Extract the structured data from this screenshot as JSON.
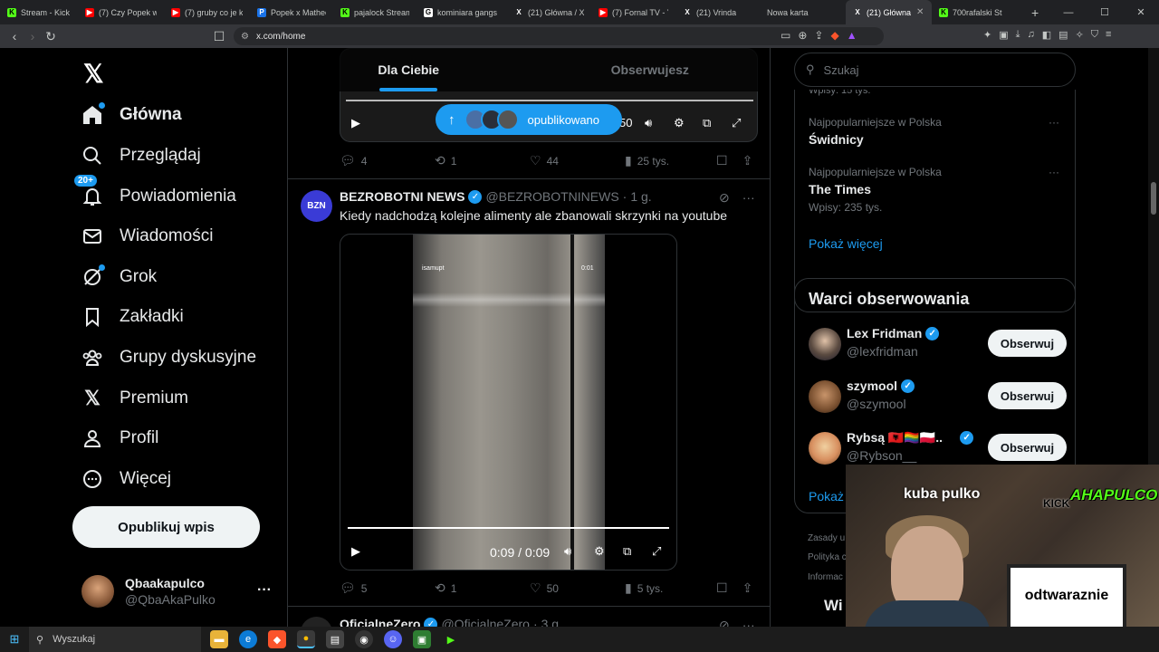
{
  "browser": {
    "tabs": [
      {
        "label": "Stream - Kick",
        "icon": "kick-icon",
        "color": "#53fc18",
        "glyph": "K"
      },
      {
        "label": "(7) Czy Popek w b",
        "icon": "youtube-icon",
        "color": "#ff0000",
        "glyph": "▶"
      },
      {
        "label": "(7) gruby co je ko",
        "icon": "youtube-icon",
        "color": "#ff0000",
        "glyph": "▶"
      },
      {
        "label": "Popek x Matheo",
        "icon": "page-icon",
        "color": "#1a73e8",
        "glyph": "P"
      },
      {
        "label": "pajalock Stream",
        "icon": "kick-icon",
        "color": "#53fc18",
        "glyph": "K"
      },
      {
        "label": "kominiara gangs",
        "icon": "google-icon",
        "color": "#ffffff",
        "glyph": "G"
      },
      {
        "label": "(21) Główna / X",
        "icon": "x-icon",
        "color": "#000000",
        "glyph": "X"
      },
      {
        "label": "(7) Fornal TV - Yo",
        "icon": "youtube-icon",
        "color": "#ff0000",
        "glyph": "▶"
      },
      {
        "label": "(21) Vrinda",
        "icon": "x-icon",
        "color": "#000000",
        "glyph": "X"
      },
      {
        "label": "Nowa karta",
        "icon": "",
        "color": "",
        "glyph": ""
      },
      {
        "label": "(21) Główna",
        "icon": "x-icon",
        "color": "#000000",
        "glyph": "X",
        "active": true
      },
      {
        "label": "700rafalski St",
        "icon": "kick-icon",
        "color": "#53fc18",
        "glyph": "K"
      }
    ],
    "url": "x.com/home"
  },
  "nav": {
    "items": [
      {
        "label": "Główna",
        "icon": "home-icon"
      },
      {
        "label": "Przeglądaj",
        "icon": "search-icon"
      },
      {
        "label": "Powiadomienia",
        "icon": "bell-icon",
        "badge": "20+"
      },
      {
        "label": "Wiadomości",
        "icon": "mail-icon"
      },
      {
        "label": "Grok",
        "icon": "grok-icon"
      },
      {
        "label": "Zakładki",
        "icon": "bookmark-icon"
      },
      {
        "label": "Grupy dyskusyjne",
        "icon": "people-icon"
      },
      {
        "label": "Premium",
        "icon": "x-icon"
      },
      {
        "label": "Profil",
        "icon": "person-icon"
      },
      {
        "label": "Więcej",
        "icon": "more-icon"
      }
    ],
    "post_button": "Opublikuj wpis",
    "account": {
      "display_name": "Qbaakapulco",
      "handle": "@QbaAkaPulko"
    }
  },
  "feed": {
    "tabs": [
      "Dla Ciebie",
      "Obserwujesz"
    ],
    "new_posts_pill": "opublikowano",
    "post1": {
      "video_time_fragment": "50",
      "replies": "4",
      "reposts": "1",
      "likes": "44",
      "views": "25 tys."
    },
    "post2": {
      "display_name": "BEZROBOTNI NEWS",
      "handle": "@BEZROBOTNINEWS",
      "time": "1 g.",
      "text": "Kiedy nadchodzą kolejne alimenty ale zbanowali skrzynki na youtube",
      "avatar_text": "BZN",
      "video_watermark_user": "isamupt",
      "video_watermark_time": "0:01",
      "video_time": "0:09 / 0:09",
      "replies": "5",
      "reposts": "1",
      "likes": "50",
      "views": "5 tys."
    },
    "post3": {
      "display_name": "OficjalneZero",
      "handle": "@OficjalneZero",
      "time": "3 g."
    }
  },
  "sidebar": {
    "search_placeholder": "Szukaj",
    "trend_top_fragment": "Wpisy: 15 tys.",
    "trends": [
      {
        "context": "Najpopularniejsze w Polska",
        "title": "Świdnicy",
        "count": ""
      },
      {
        "context": "Najpopularniejsze w Polska",
        "title": "The Times",
        "count": "Wpisy: 235 tys."
      }
    ],
    "show_more": "Pokaż więcej",
    "who_to_follow_title": "Warci obserwowania",
    "who_to_follow": [
      {
        "name": "Lex Fridman",
        "handle": "@lexfridman",
        "button": "Obserwuj"
      },
      {
        "name": "szymool",
        "handle": "@szymool",
        "button": "Obserwuj"
      },
      {
        "name": "Rybsą 🇦🇱🏳️‍🌈🇵🇱...",
        "handle": "@Rybson__",
        "button": "Obserwuj"
      }
    ],
    "show_more_2": "Pokaż w",
    "footer": [
      "Zasady u",
      "Polityka c",
      "Informac"
    ]
  },
  "overlay": {
    "name_label": "kuba pulko",
    "kick_label": "KICK",
    "logo_text": "AHAPULCO",
    "board_text": "odtwaraznie",
    "partial_text": "Wi"
  },
  "taskbar": {
    "search_placeholder": "Wyszukaj"
  }
}
